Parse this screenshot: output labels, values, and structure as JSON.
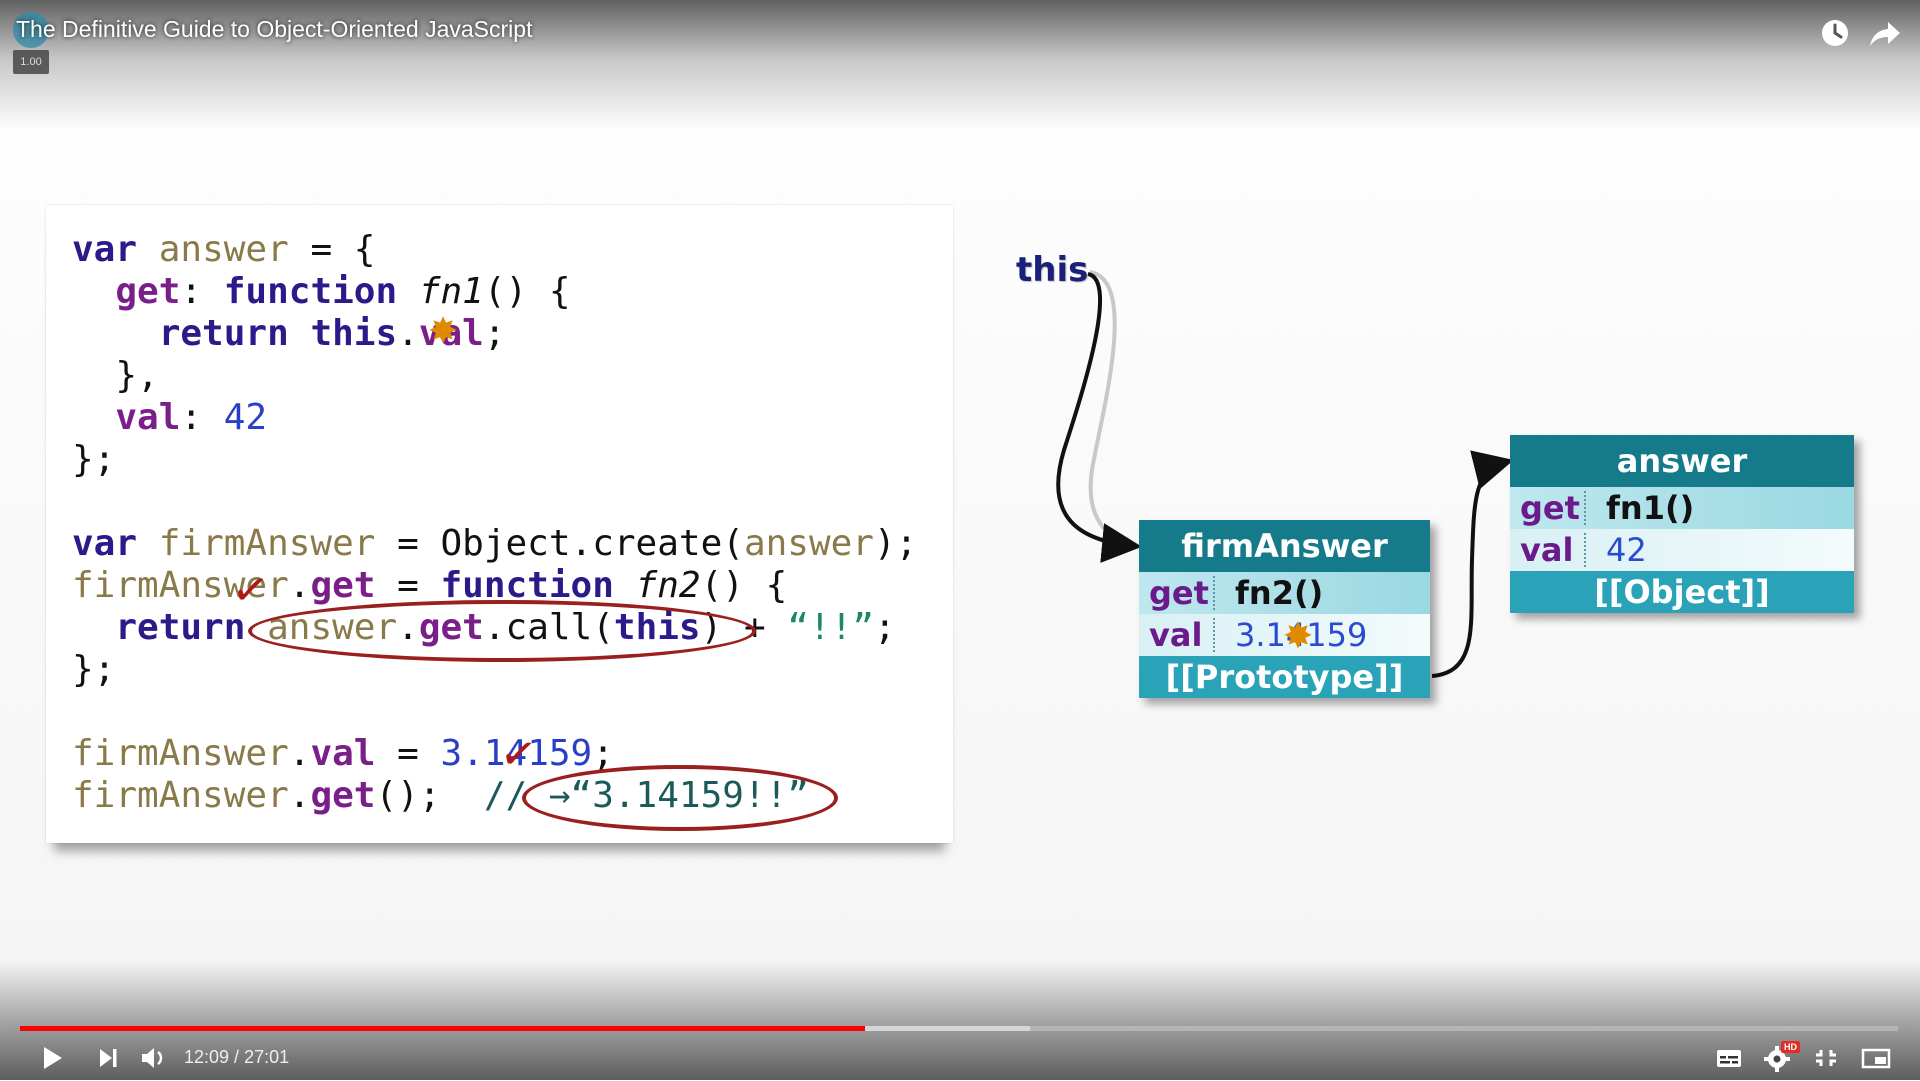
{
  "player": {
    "title": "The Definitive Guide to Object-Oriented JavaScript",
    "speed_badge": "1.00",
    "time_current": "12:09",
    "time_separator": " / ",
    "time_total": "27:01",
    "progress_played_fraction": 0.4497,
    "progress_buffered_fraction": 0.538,
    "accent_color": "#ff0000",
    "hd_badge": "HD",
    "icons": {
      "watch_later": "clock-icon",
      "share": "share-arrow-icon",
      "play": "play-icon",
      "next": "next-icon",
      "volume": "volume-icon",
      "captions": "subtitles-icon",
      "settings": "gear-icon",
      "exit_fullscreen": "exit-fullscreen-icon",
      "miniplayer": "miniplayer-icon"
    }
  },
  "slide": {
    "code_lines": [
      {
        "segs": [
          [
            "kw",
            "var"
          ],
          [
            "plain",
            " "
          ],
          [
            "varn",
            "answer"
          ],
          [
            "plain",
            " = {"
          ]
        ]
      },
      {
        "segs": [
          [
            "plain",
            "  "
          ],
          [
            "prop",
            "get"
          ],
          [
            "plain",
            ": "
          ],
          [
            "kw",
            "function"
          ],
          [
            "plain",
            " "
          ],
          [
            "fname",
            "fn1"
          ],
          [
            "plain",
            "() {"
          ]
        ]
      },
      {
        "segs": [
          [
            "plain",
            "    "
          ],
          [
            "kw",
            "return"
          ],
          [
            "plain",
            " "
          ],
          [
            "kw",
            "this"
          ],
          [
            "plain",
            "."
          ],
          [
            "prop",
            "val"
          ],
          [
            "plain",
            ";"
          ]
        ]
      },
      {
        "segs": [
          [
            "plain",
            "  },"
          ]
        ]
      },
      {
        "segs": [
          [
            "plain",
            "  "
          ],
          [
            "prop",
            "val"
          ],
          [
            "plain",
            ": "
          ],
          [
            "num",
            "42"
          ]
        ]
      },
      {
        "segs": [
          [
            "plain",
            "};"
          ]
        ]
      },
      {
        "segs": []
      },
      {
        "segs": [
          [
            "kw",
            "var"
          ],
          [
            "plain",
            " "
          ],
          [
            "varn",
            "firmAnswer"
          ],
          [
            "plain",
            " = Object.create("
          ],
          [
            "varn",
            "answer"
          ],
          [
            "plain",
            ");"
          ]
        ]
      },
      {
        "segs": [
          [
            "varn",
            "firmAnswer"
          ],
          [
            "plain",
            "."
          ],
          [
            "prop",
            "get"
          ],
          [
            "plain",
            " = "
          ],
          [
            "kw",
            "function"
          ],
          [
            "plain",
            " "
          ],
          [
            "fname",
            "fn2"
          ],
          [
            "plain",
            "() {"
          ]
        ]
      },
      {
        "segs": [
          [
            "plain",
            "  "
          ],
          [
            "kw",
            "return"
          ],
          [
            "plain",
            " "
          ],
          [
            "varn",
            "answer"
          ],
          [
            "plain",
            "."
          ],
          [
            "prop",
            "get"
          ],
          [
            "plain",
            ".call("
          ],
          [
            "kw",
            "this"
          ],
          [
            "plain",
            ") + "
          ],
          [
            "str",
            "“!!”"
          ],
          [
            "plain",
            ";"
          ]
        ]
      },
      {
        "segs": [
          [
            "plain",
            "};"
          ]
        ]
      },
      {
        "segs": []
      },
      {
        "segs": [
          [
            "varn",
            "firmAnswer"
          ],
          [
            "plain",
            "."
          ],
          [
            "prop",
            "val"
          ],
          [
            "plain",
            " = "
          ],
          [
            "num",
            "3.14159"
          ],
          [
            "plain",
            ";"
          ]
        ]
      },
      {
        "segs": [
          [
            "varn",
            "firmAnswer"
          ],
          [
            "plain",
            "."
          ],
          [
            "prop",
            "get"
          ],
          [
            "plain",
            "();  "
          ],
          [
            "cmt",
            "// →“3.14159!!”"
          ]
        ]
      }
    ],
    "this_label": "this",
    "firm_box": {
      "name": "firmAnswer",
      "rows": [
        {
          "key": "get",
          "value": "fn2()"
        },
        {
          "key": "val",
          "value": "3.14159"
        }
      ],
      "prototype": "[[Prototype]]"
    },
    "answer_box": {
      "name": "answer",
      "rows": [
        {
          "key": "get",
          "value": "fn1()"
        },
        {
          "key": "val",
          "value": "42"
        }
      ],
      "prototype": "[[Object]]"
    }
  }
}
